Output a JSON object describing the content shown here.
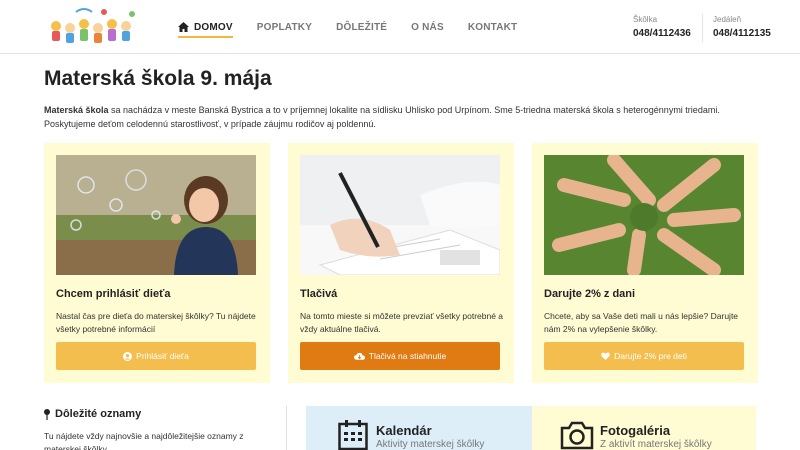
{
  "header": {
    "logo_alt": "kids-logo",
    "nav": [
      {
        "label": "DOMOV",
        "active": true
      },
      {
        "label": "POPLATKY",
        "active": false
      },
      {
        "label": "DÔLEŽITÉ",
        "active": false
      },
      {
        "label": "O NÁS",
        "active": false
      },
      {
        "label": "KONTAKT",
        "active": false
      }
    ],
    "contacts": [
      {
        "label": "Škôlka",
        "number": "048/4112436"
      },
      {
        "label": "Jedáleň",
        "number": "048/4112135"
      }
    ]
  },
  "main": {
    "title_bold": "Materská škola",
    "title_rest": " 9. mája",
    "intro_bold": "Materská škola",
    "intro_rest": " sa nachádza v meste Banská Bystrica a to v príjemnej lokalite na sídlisku Uhlisko pod Urpínom. Sme 5-triedna materská škola s heterogénnymi triedami. Poskytujeme deťom celodennú starostlivosť, v prípade záujmu rodičov aj poldennú."
  },
  "cards": [
    {
      "title": "Chcem prihlásiť dieťa",
      "text": "Nastal čas pre dieťa do materskej škôlky? Tu nájdete všetky potrebné informácií",
      "button": "Prihlásiť dieťa",
      "button_icon": "user-circle-icon",
      "button_color": "#f3be4e"
    },
    {
      "title": "Tlačivá",
      "text": "Na tomto mieste si môžete prevziať všetky potrebné a vždy aktuálne tlačivá.",
      "button": "Tlačivá na stiahnutie",
      "button_icon": "cloud-download-icon",
      "button_color": "#e07a12"
    },
    {
      "title": "Darujte 2% z dani",
      "text": "Chcete, aby sa Vaše deti mali u nás lepšie? Darujte nám 2% na vylepšenie škôlky.",
      "button": "Darujte 2% pre deti",
      "button_icon": "heart-icon",
      "button_color": "#f3be4e"
    }
  ],
  "notices": {
    "title": "Dôležité oznamy",
    "text": "Tu nájdete vždy najnovšie a najdôležitejšie oznamy z materskej škôlky."
  },
  "tiles": [
    {
      "title": "Kalendár",
      "subtitle": "Aktivity materskej škôlky",
      "icon": "calendar-icon"
    },
    {
      "title": "Fotogaléria",
      "subtitle": "Z aktivít materskej škôlky",
      "icon": "camera-icon"
    }
  ],
  "colors": {
    "accent": "#f0b840",
    "card_bg": "#fffbd2",
    "tile_blue": "#ddeef8",
    "orange": "#e07a12"
  }
}
